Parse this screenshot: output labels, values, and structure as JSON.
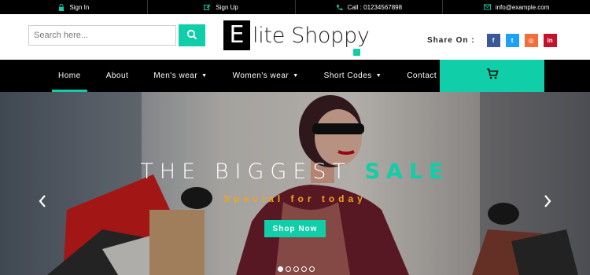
{
  "topbar": {
    "items": [
      {
        "label": "Sign In",
        "icon": "lock-icon"
      },
      {
        "label": "Sign Up",
        "icon": "edit-icon"
      },
      {
        "label": "Call : 01234567898",
        "icon": "phone-icon"
      },
      {
        "label": "info@example.com",
        "icon": "envelope-icon"
      }
    ]
  },
  "header": {
    "search_placeholder": "Search here...",
    "logo_letter": "E",
    "logo_text": "lite Shoppy",
    "share_label": "Share On :",
    "social": [
      {
        "name": "facebook",
        "glyph": "f",
        "color": "#3b5998"
      },
      {
        "name": "twitter",
        "glyph": "t",
        "color": "#1da1f2"
      },
      {
        "name": "instagram",
        "glyph": "◎",
        "color": "#f16f3b"
      },
      {
        "name": "linkedin",
        "glyph": "in",
        "color": "#c4122c"
      }
    ]
  },
  "nav": {
    "items": [
      {
        "label": "Home",
        "dropdown": false,
        "active": true
      },
      {
        "label": "About",
        "dropdown": false,
        "active": false
      },
      {
        "label": "Men's wear",
        "dropdown": true,
        "active": false
      },
      {
        "label": "Women's wear",
        "dropdown": true,
        "active": false
      },
      {
        "label": "Short Codes",
        "dropdown": true,
        "active": false
      },
      {
        "label": "Contact",
        "dropdown": false,
        "active": false
      }
    ]
  },
  "hero": {
    "title_main": "THE BIGGEST",
    "title_highlight": "SALE",
    "subtitle": "Special for today",
    "button": "Shop Now",
    "slides": 5,
    "active_slide": 1
  },
  "colors": {
    "accent": "#0fcea8",
    "subtitle": "#f2a31b",
    "bar": "#000000"
  }
}
